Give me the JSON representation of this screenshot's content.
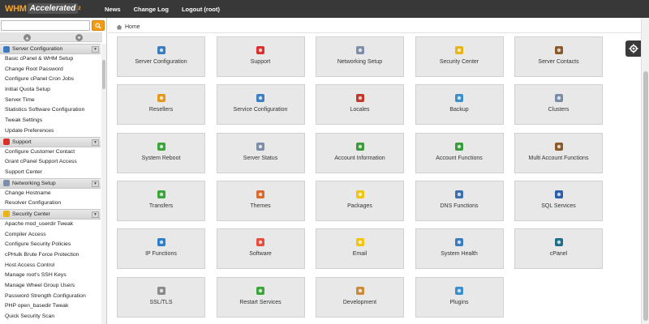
{
  "header": {
    "logo_text": "WHM",
    "logo_sub": "Accelerated",
    "logo_sup": "2",
    "nav": [
      "News",
      "Change Log",
      "Logout (root)"
    ]
  },
  "search": {
    "placeholder": "",
    "value": ""
  },
  "sidebar": {
    "sections": [
      {
        "title": "Server Configuration",
        "icon": "server-config-icon",
        "items": [
          "Basic cPanel & WHM Setup",
          "Change Root Password",
          "Configure cPanel Cron Jobs",
          "Initial Quota Setup",
          "Server Time",
          "Statistics Software Configuration",
          "Tweak Settings",
          "Update Preferences"
        ]
      },
      {
        "title": "Support",
        "icon": "support-icon",
        "items": [
          "Configure Customer Contact",
          "Grant cPanel Support Access",
          "Support Center"
        ]
      },
      {
        "title": "Networking Setup",
        "icon": "networking-icon",
        "items": [
          "Change Hostname",
          "Resolver Configuration"
        ]
      },
      {
        "title": "Security Center",
        "icon": "lock-icon",
        "items": [
          "Apache mod_userdir Tweak",
          "Compiler Access",
          "Configure Security Policies",
          "cPHulk Brute Force Protection",
          "Host Access Control",
          "Manage root's SSH Keys",
          "Manage Wheel Group Users",
          "Password Strength Configuration",
          "PHP open_basedir Tweak",
          "Quick Security Scan"
        ]
      }
    ]
  },
  "breadcrumb": {
    "label": "Home"
  },
  "tiles": [
    {
      "label": "Server Configuration",
      "icon": "server-config-icon",
      "color": "#3b7bbf"
    },
    {
      "label": "Support",
      "icon": "lifebuoy-icon",
      "color": "#d9302c"
    },
    {
      "label": "Networking Setup",
      "icon": "network-icon",
      "color": "#7d8fa8"
    },
    {
      "label": "Security Center",
      "icon": "lock-icon",
      "color": "#e8b416"
    },
    {
      "label": "Server Contacts",
      "icon": "contact-icon",
      "color": "#8a5a2b"
    },
    {
      "label": "Resellers",
      "icon": "resellers-icon",
      "color": "#e39a1c"
    },
    {
      "label": "Service Configuration",
      "icon": "gear-icon",
      "color": "#3e7fc4"
    },
    {
      "label": "Locales",
      "icon": "flag-icon",
      "color": "#c0392b"
    },
    {
      "label": "Backup",
      "icon": "backup-icon",
      "color": "#3b8fcc"
    },
    {
      "label": "Clusters",
      "icon": "clusters-icon",
      "color": "#7a8da6"
    },
    {
      "label": "System Reboot",
      "icon": "power-icon",
      "color": "#3aa53a"
    },
    {
      "label": "Server Status",
      "icon": "server-status-icon",
      "color": "#7d8fa8"
    },
    {
      "label": "Account Information",
      "icon": "account-info-icon",
      "color": "#3a9b3a"
    },
    {
      "label": "Account Functions",
      "icon": "account-functions-icon",
      "color": "#3a9b3a"
    },
    {
      "label": "Multi Account Functions",
      "icon": "multi-account-icon",
      "color": "#8a5a2b"
    },
    {
      "label": "Transfers",
      "icon": "transfers-icon",
      "color": "#3aa53a"
    },
    {
      "label": "Themes",
      "icon": "themes-icon",
      "color": "#d96a2c"
    },
    {
      "label": "Packages",
      "icon": "packages-icon",
      "color": "#f1c40f"
    },
    {
      "label": "DNS Functions",
      "icon": "dns-icon",
      "color": "#3b6fae"
    },
    {
      "label": "SQL Services",
      "icon": "sql-icon",
      "color": "#2b5da8"
    },
    {
      "label": "IP Functions",
      "icon": "ip-icon",
      "color": "#2f7fc6"
    },
    {
      "label": "Software",
      "icon": "software-icon",
      "color": "#e74c3c"
    },
    {
      "label": "Email",
      "icon": "email-icon",
      "color": "#f1c40f"
    },
    {
      "label": "System Health",
      "icon": "system-health-icon",
      "color": "#3b7bbf"
    },
    {
      "label": "cPanel",
      "icon": "cpanel-icon",
      "color": "#1f6f8b"
    },
    {
      "label": "SSL/TLS",
      "icon": "certificate-icon",
      "color": "#8a8a8a"
    },
    {
      "label": "Restart Services",
      "icon": "restart-icon",
      "color": "#3aa53a"
    },
    {
      "label": "Development",
      "icon": "development-icon",
      "color": "#c98a3a"
    },
    {
      "label": "Plugins",
      "icon": "plugins-icon",
      "color": "#3b8fcc"
    }
  ],
  "colors": {
    "topbar": "#383838",
    "accent_orange": "#f39c12",
    "tile_bg": "#e8e8e8"
  }
}
